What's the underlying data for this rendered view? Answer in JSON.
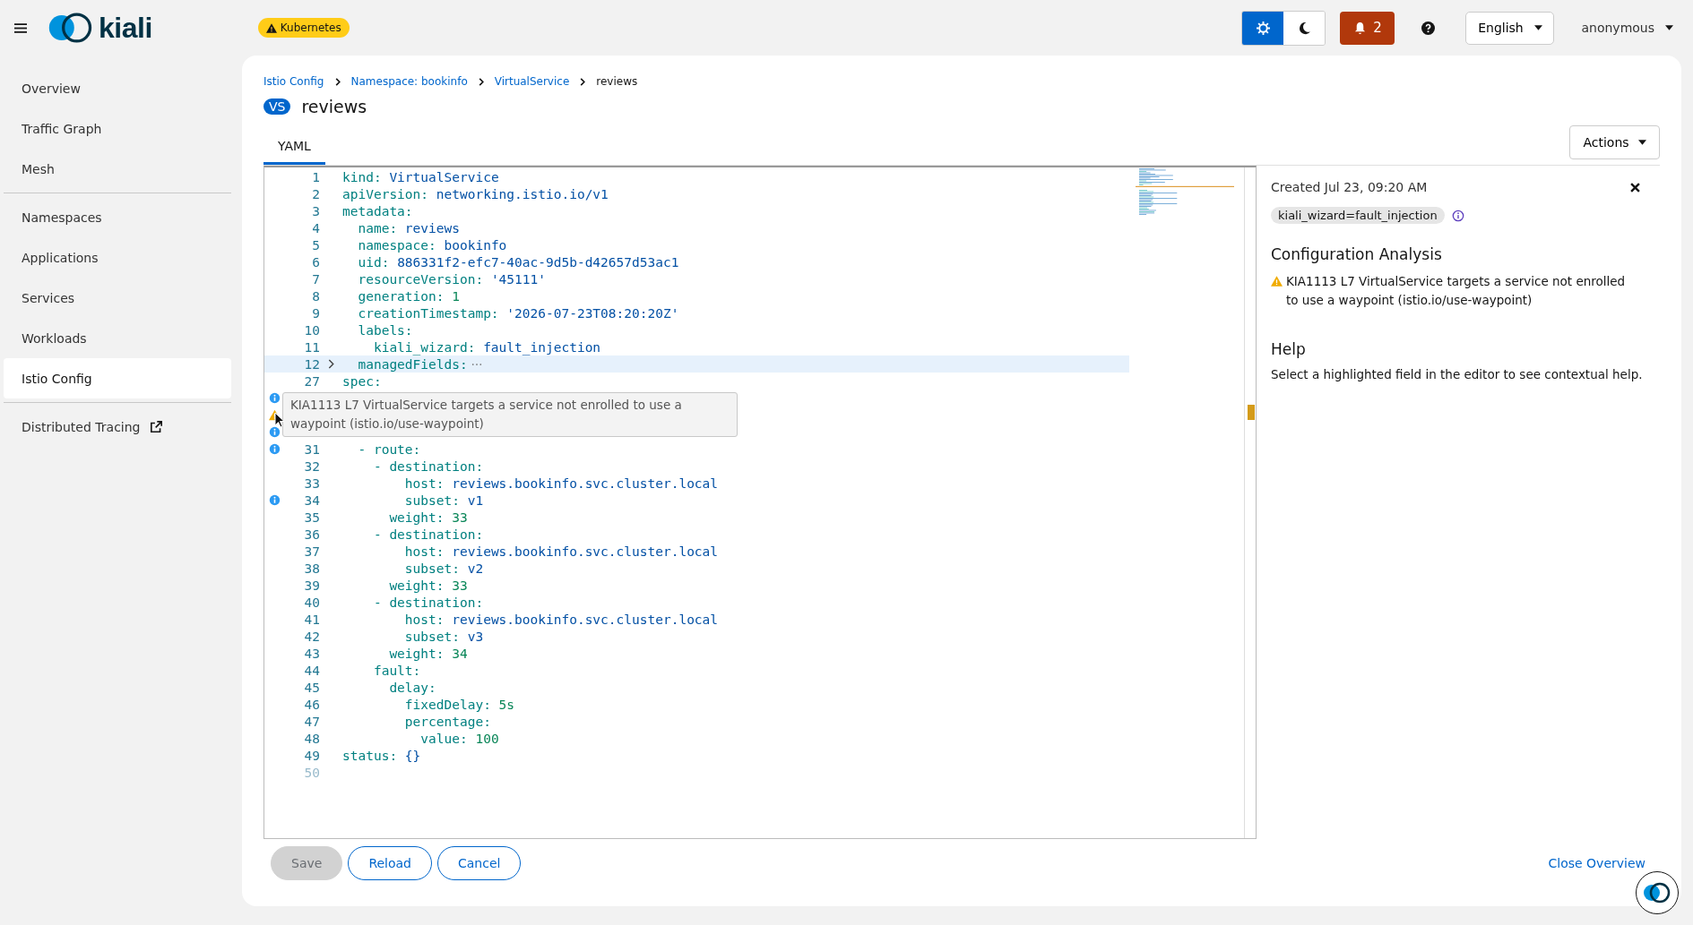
{
  "header": {
    "brand": "kiali",
    "badge": "Kubernetes",
    "theme": [
      {
        "kind": "light",
        "selected": true
      },
      {
        "kind": "dark",
        "selected": false
      }
    ],
    "notifications": "2",
    "language": "English",
    "user": "anonymous"
  },
  "sidebar": {
    "groups": [
      [
        {
          "label": "Overview",
          "selected": false
        },
        {
          "label": "Traffic Graph",
          "selected": false
        },
        {
          "label": "Mesh",
          "selected": false
        }
      ],
      [
        {
          "label": "Namespaces",
          "selected": false
        },
        {
          "label": "Applications",
          "selected": false
        },
        {
          "label": "Services",
          "selected": false
        },
        {
          "label": "Workloads",
          "selected": false
        },
        {
          "label": "Istio Config",
          "selected": true
        }
      ],
      [
        {
          "label": "Distributed Tracing",
          "selected": false,
          "external": true
        }
      ]
    ]
  },
  "breadcrumbs": [
    {
      "label": "Istio Config",
      "link": true
    },
    {
      "label": "Namespace: bookinfo",
      "link": true
    },
    {
      "label": "VirtualService",
      "link": true
    },
    {
      "label": "reviews",
      "link": false
    }
  ],
  "title": {
    "badge": "VS",
    "name": "reviews"
  },
  "tabs": [
    {
      "label": "YAML",
      "selected": true
    }
  ],
  "actions": "Actions",
  "editor": {
    "lines": [
      {
        "num": "1",
        "code": "kind:",
        "value": "VirtualService",
        "kind": "string"
      },
      {
        "num": "2",
        "code": "apiVersion:",
        "value": "networking.istio.io/v1",
        "kind": "string"
      },
      {
        "num": "3",
        "code": "metadata:"
      },
      {
        "num": "4",
        "code": "  name:",
        "value": "reviews",
        "kind": "string"
      },
      {
        "num": "5",
        "code": "  namespace:",
        "value": "bookinfo",
        "kind": "string"
      },
      {
        "num": "6",
        "code": "  uid:",
        "value": "886331f2-efc7-40ac-9d5b-d42657d53ac1",
        "kind": "string"
      },
      {
        "num": "7",
        "code": "  resourceVersion:",
        "value": "'45111'",
        "kind": "string"
      },
      {
        "num": "8",
        "code": "  generation:",
        "value": "1",
        "kind": "number"
      },
      {
        "num": "9",
        "code": "  creationTimestamp:",
        "value": "'2026-07-23T08:20:20Z'",
        "kind": "string"
      },
      {
        "num": "10",
        "code": "  labels:"
      },
      {
        "num": "11",
        "code": "    kiali_wizard:",
        "value": "fault_injection",
        "kind": "string"
      },
      {
        "num": "12",
        "code": "  managedFields:",
        "folded": true,
        "highlighted": true
      },
      {
        "num": "27",
        "code": "spec:"
      },
      {
        "marker": {
          "kind": "info"
        }
      },
      {
        "marker": {
          "kind": "warning"
        }
      },
      {
        "marker": {
          "kind": "info"
        }
      },
      {
        "num": "31",
        "code": "  - route:",
        "marker": {
          "kind": "info"
        }
      },
      {
        "num": "32",
        "code": "    - destination:"
      },
      {
        "num": "33",
        "code": "        host:",
        "value": "reviews.bookinfo.svc.cluster.local",
        "kind": "string"
      },
      {
        "num": "34",
        "code": "        subset:",
        "value": "v1",
        "kind": "string",
        "marker": {
          "kind": "info"
        }
      },
      {
        "num": "35",
        "code": "      weight:",
        "value": "33",
        "kind": "number"
      },
      {
        "num": "36",
        "code": "    - destination:"
      },
      {
        "num": "37",
        "code": "        host:",
        "value": "reviews.bookinfo.svc.cluster.local",
        "kind": "string"
      },
      {
        "num": "38",
        "code": "        subset:",
        "value": "v2",
        "kind": "string"
      },
      {
        "num": "39",
        "code": "      weight:",
        "value": "33",
        "kind": "number"
      },
      {
        "num": "40",
        "code": "    - destination:"
      },
      {
        "num": "41",
        "code": "        host:",
        "value": "reviews.bookinfo.svc.cluster.local",
        "kind": "string"
      },
      {
        "num": "42",
        "code": "        subset:",
        "value": "v3",
        "kind": "string"
      },
      {
        "num": "43",
        "code": "      weight:",
        "value": "34",
        "kind": "number"
      },
      {
        "num": "44",
        "code": "    fault:"
      },
      {
        "num": "45",
        "code": "      delay:"
      },
      {
        "num": "46",
        "code": "        fixedDelay:",
        "value": "5s",
        "kind": "number"
      },
      {
        "num": "47",
        "code": "        percentage:"
      },
      {
        "num": "48",
        "code": "          value:",
        "value": "100",
        "kind": "number"
      },
      {
        "num": "49",
        "code": "status:",
        "value": "{}",
        "kind": "string"
      },
      {
        "num": "50"
      }
    ],
    "tooltip": "KIA1113 L7 VirtualService targets a service not enrolled to use a waypoint (istio.io/use-waypoint)"
  },
  "overview": {
    "created": "Created Jul 23, 09:20 AM",
    "label": "kiali_wizard=fault_injection",
    "analysis_title": "Configuration Analysis",
    "analysis": "KIA1113 L7 VirtualService targets a service not enrolled to use a waypoint (istio.io/use-waypoint)",
    "help_title": "Help",
    "help": "Select a highlighted field in the editor to see contextual help.",
    "close": "Close Overview"
  },
  "buttons": [
    {
      "label": "Save",
      "disabled": true
    },
    {
      "label": "Reload",
      "disabled": false
    },
    {
      "label": "Cancel",
      "disabled": false
    }
  ]
}
